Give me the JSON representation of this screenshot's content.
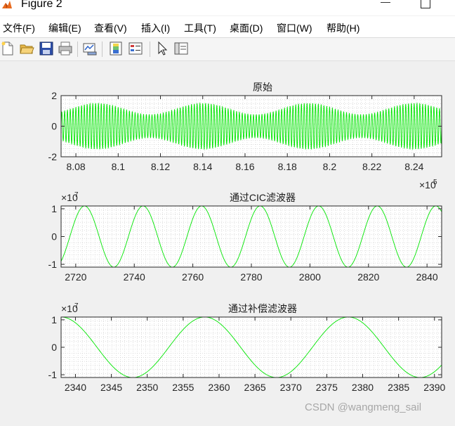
{
  "window": {
    "title": "Figure 2",
    "minimize_glyph": "—",
    "icon": "matlab-icon"
  },
  "menu": [
    {
      "label": "文件(F)"
    },
    {
      "label": "编辑(E)"
    },
    {
      "label": "查看(V)"
    },
    {
      "label": "插入(I)"
    },
    {
      "label": "工具(T)"
    },
    {
      "label": "桌面(D)"
    },
    {
      "label": "窗口(W)"
    },
    {
      "label": "帮助(H)"
    }
  ],
  "toolbar_icons": [
    "new-file-icon",
    "open-folder-icon",
    "save-icon",
    "print-icon",
    "link-plot-icon",
    "colorbar-icon",
    "legend-icon",
    "pointer-icon",
    "property-editor-icon"
  ],
  "colors": {
    "signal": "#00e600",
    "axes_bg": "#ffffff",
    "figure_bg": "#f0f0f0"
  },
  "chart_data": [
    {
      "type": "line",
      "title": "原始",
      "xlim": [
        807300,
        825300
      ],
      "ylim": [
        -2,
        2
      ],
      "xticks": [
        808000,
        810000,
        812000,
        814000,
        816000,
        818000,
        820000,
        822000,
        824000
      ],
      "xtick_labels": [
        "8.08",
        "8.1",
        "8.12",
        "8.14",
        "8.16",
        "8.18",
        "8.2",
        "8.22",
        "8.24"
      ],
      "yticks": [
        -2,
        0,
        2
      ],
      "ytick_labels": [
        "-2",
        "0",
        "2"
      ],
      "x_exponent": "×10",
      "x_exponent_power": "5",
      "grid": "minor-dotted",
      "series": [
        {
          "envelope_period": 5000,
          "envelope_phase_x": 814000,
          "carrier_cycles": 135,
          "amplitude_max": 2.0,
          "amplitude_min": 1.0
        }
      ]
    },
    {
      "type": "line",
      "title": "通过CIC滤波器",
      "xlim": [
        2715,
        2845
      ],
      "ylim": [
        -1.1,
        1.1
      ],
      "xticks": [
        2720,
        2740,
        2760,
        2780,
        2800,
        2820,
        2840
      ],
      "xtick_labels": [
        "2720",
        "2740",
        "2760",
        "2780",
        "2800",
        "2820",
        "2840"
      ],
      "yticks": [
        -1,
        0,
        1
      ],
      "ytick_labels": [
        "-1",
        "0",
        "1"
      ],
      "y_exponent": "×10",
      "y_exponent_power": "7",
      "grid": "minor-dotted",
      "series": [
        {
          "period": 20,
          "peak_x": 2723,
          "amplitude": 1.1
        }
      ]
    },
    {
      "type": "line",
      "title": "通过补偿滤波器",
      "xlim": [
        2338,
        2391
      ],
      "ylim": [
        -1.1,
        1.1
      ],
      "xticks": [
        2340,
        2345,
        2350,
        2355,
        2360,
        2365,
        2370,
        2375,
        2380,
        2385,
        2390
      ],
      "xtick_labels": [
        "2340",
        "2345",
        "2350",
        "2355",
        "2360",
        "2365",
        "2370",
        "2375",
        "2380",
        "2385",
        "2390"
      ],
      "yticks": [
        -1,
        0,
        1
      ],
      "ytick_labels": [
        "-1",
        "0",
        "1"
      ],
      "y_exponent": "×10",
      "y_exponent_power": "7",
      "grid": "minor-dotted",
      "series": [
        {
          "period": 20,
          "peak_x": 2338,
          "amplitude": 1.1
        }
      ]
    }
  ],
  "watermark": "CSDN @wangmeng_sail"
}
